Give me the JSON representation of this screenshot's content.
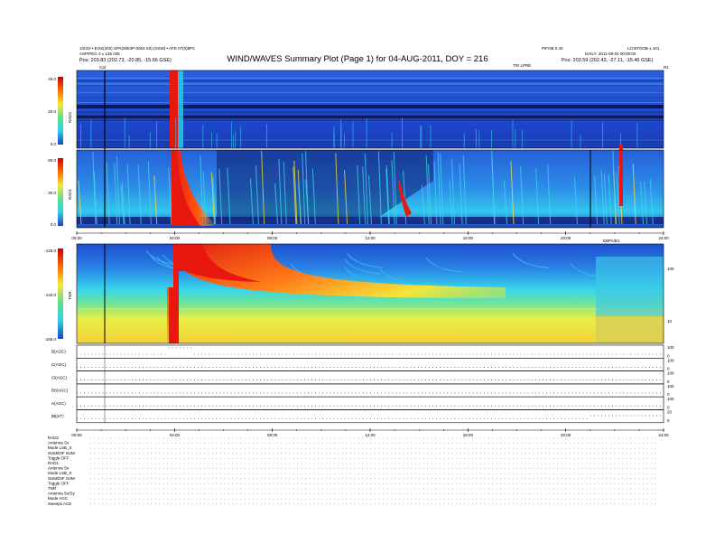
{
  "header": {
    "title": "WIND/WAVES Summary Plot (Page 1) for 04-AUG-2011, DOY = 216",
    "left_line1": "10/3/3 • EOS(200) SPA(0053P-0053 S0) (SSW) • AFE 07(0)8PC",
    "left_line2": "ASP/PEG 3 ± 135 035",
    "left_line3": "Pos: 203.83 (202.73, -20.85, -15.66 GSE)",
    "right_line1": "P/FOB 0.40",
    "right_line2": "LO:BTOOB ± 101",
    "right_line3": "DAILY: 2011-08-04 00:00:00",
    "right_line4": "Pos: 203.59 (202.43, -27.11, -15.46 GSE)",
    "cal_label": "Cal",
    "tri_label": "TRI LPRE",
    "r_label": "R1"
  },
  "panels": {
    "rad2": {
      "name": "RAD2",
      "ticks": [
        "40.0",
        "20.0",
        "0.0"
      ]
    },
    "rad1": {
      "name": "RAD1",
      "ticks": [
        "80.0",
        "30.0",
        "0.0"
      ]
    },
    "tnr": {
      "name": "TNR",
      "ticks": [
        "-125.0",
        "-140.0",
        "-155.0"
      ],
      "right_ticks": [
        "100",
        "10"
      ]
    }
  },
  "time_axis": {
    "top": [
      "00:00",
      "04:00",
      "08:00",
      "12:00",
      "16:00",
      "20:00",
      "24:00"
    ],
    "bottom": [
      "00:00",
      "04:00",
      "08:00",
      "12:00",
      "16:00",
      "20:00",
      "24:00"
    ],
    "marker": "EBPA/B1"
  },
  "aux_panels": [
    {
      "label": "B(AGC)",
      "right": [
        "100",
        "0"
      ]
    },
    {
      "label": "C(AGC)",
      "right": [
        "100",
        "0"
      ]
    },
    {
      "label": "Cl(AGC)",
      "right": [
        "100",
        "0"
      ]
    },
    {
      "label": "B0(AGC)",
      "right": [
        "100",
        "0"
      ]
    },
    {
      "label": "A(AGC)",
      "right": [
        "100",
        "0"
      ]
    },
    {
      "label": "|B|(nT)",
      "right": [
        "20",
        "0"
      ]
    }
  ],
  "footer": [
    "RAD2",
    "Antenna    Sx",
    "Mode   LSB_S",
    "SUM/DIF  SUM",
    "Toggle    OFF",
    "RAD1",
    "Antenna    Sx",
    "Mode   LSB_S",
    "SUM/DIF  SUM",
    "Toggle    OFF",
    "TNR",
    "Antenna  Sx/Sy",
    "Mode     AGC",
    "Sweeps   ACE"
  ],
  "colors": {
    "bg_blue": "#1f5fd4",
    "mid_cyan": "#2fd0ea",
    "burst_red": "#e8180e",
    "yellow": "#f4e63a",
    "green": "#5fe08a"
  },
  "chart_data": {
    "type": "heatmap",
    "title": "WIND/WAVES Summary Plot (Page 1) for 04-AUG-2011, DOY = 216",
    "x_range": [
      "00:00",
      "24:00"
    ],
    "panels": [
      {
        "name": "RAD2",
        "y_range": [
          0.0,
          40.0
        ]
      },
      {
        "name": "RAD1",
        "y_range": [
          0.0,
          80.0
        ]
      },
      {
        "name": "TNR",
        "y_range": [
          -155.0,
          -125.0
        ]
      }
    ],
    "event_times_hours": [
      1.3,
      4.0,
      4.2,
      5.7,
      12.5,
      13.4,
      21.2,
      22.8
    ]
  }
}
